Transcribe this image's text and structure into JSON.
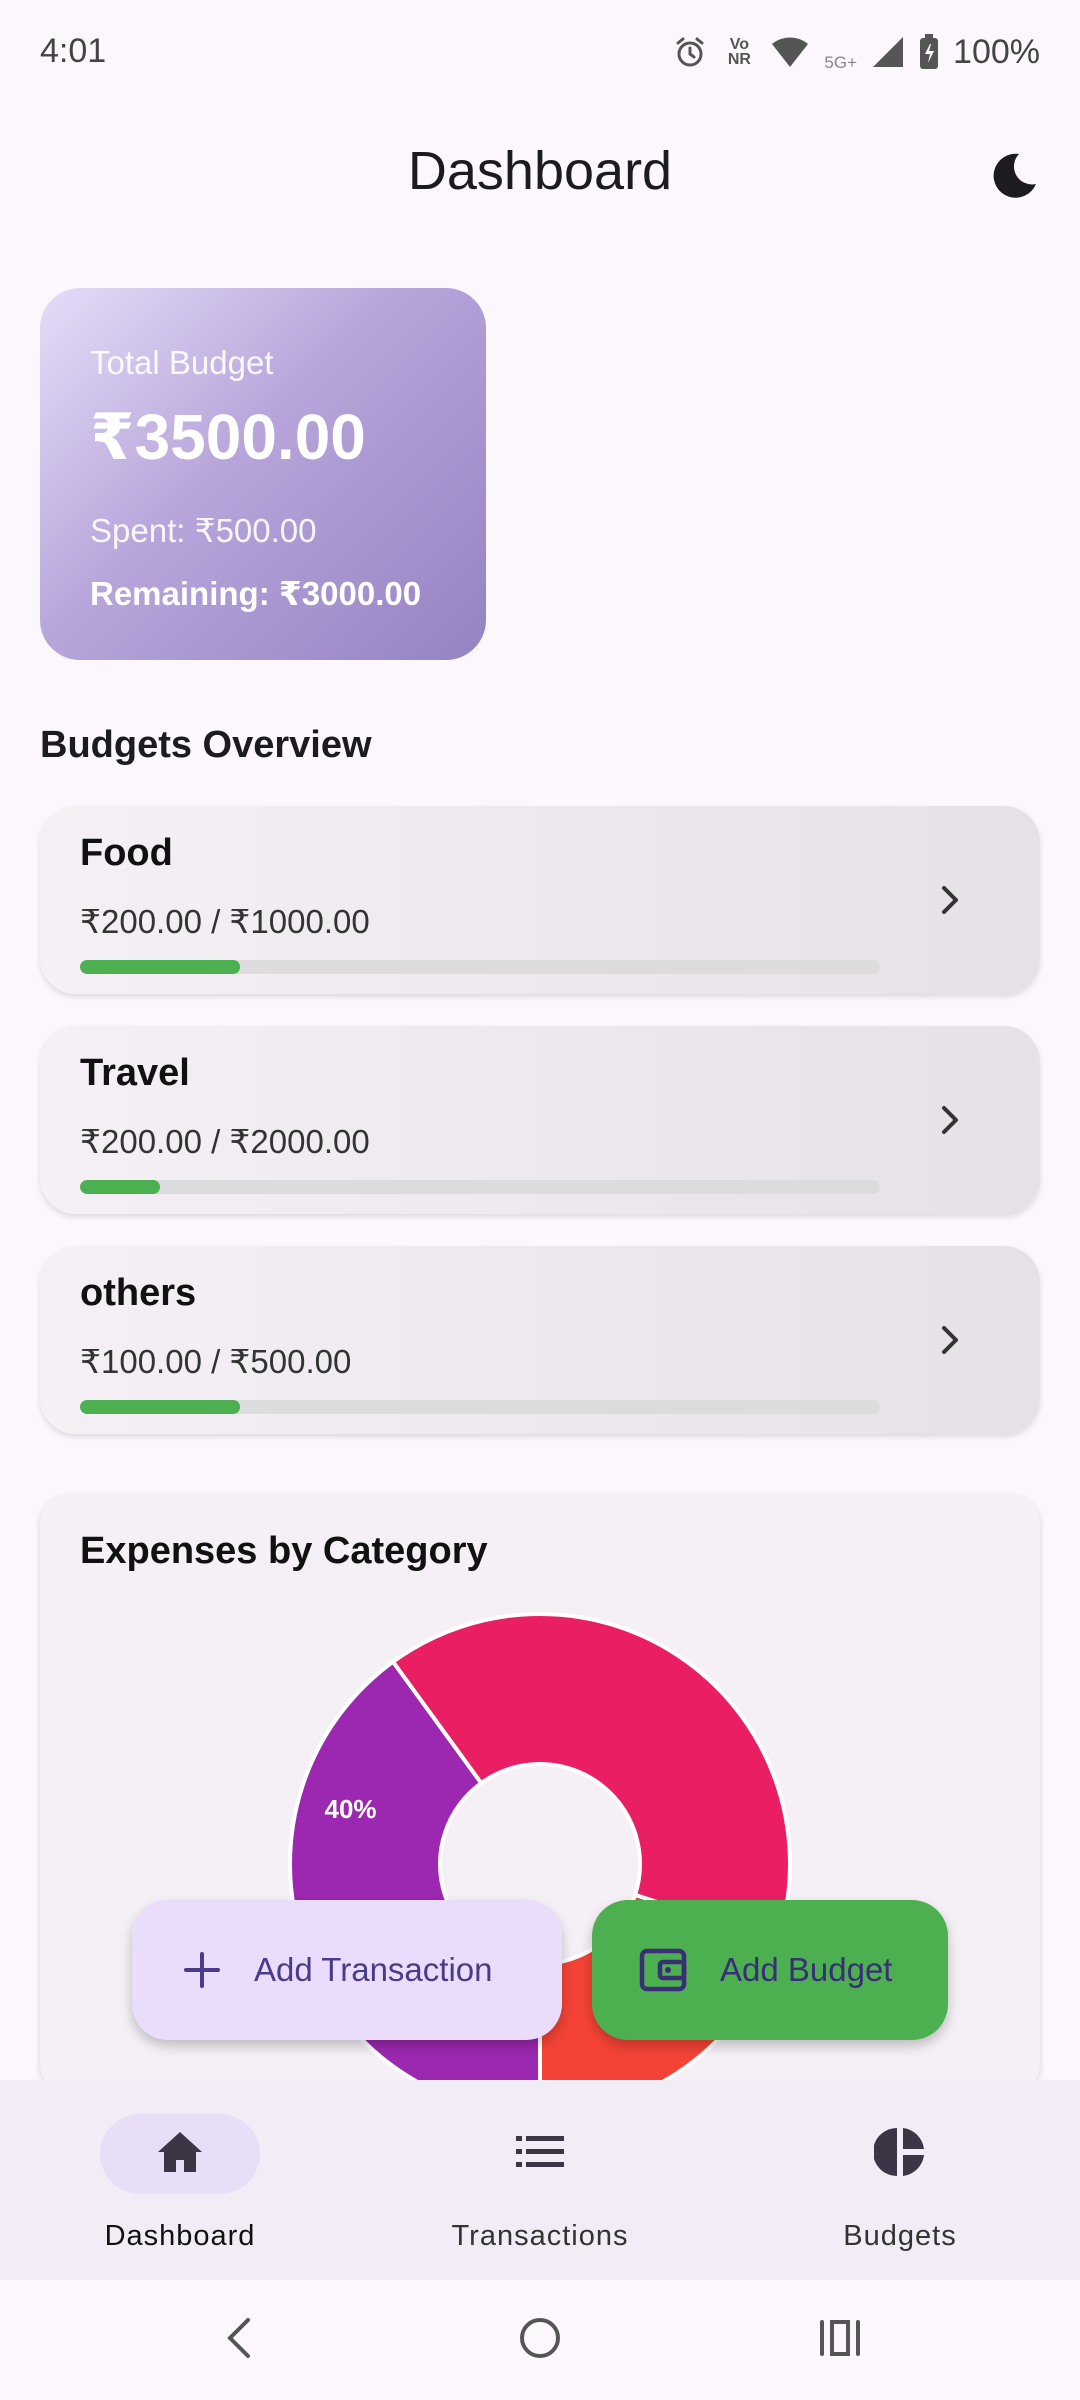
{
  "status_bar": {
    "time": "4:01",
    "volte_label": "Vo NR",
    "network_label": "5G+",
    "battery": "100%",
    "icons": [
      "alarm-icon",
      "volte-icon",
      "wifi-icon",
      "signal-icon",
      "battery-charging-icon"
    ]
  },
  "header": {
    "title": "Dashboard",
    "theme_icon": "moon-icon"
  },
  "budget_card": {
    "label": "Total Budget",
    "total": "₹3500.00",
    "spent": "Spent: ₹500.00",
    "remaining": "Remaining: ₹3000.00"
  },
  "budgets_overview": {
    "title": "Budgets Overview",
    "items": [
      {
        "name": "Food",
        "amount": "₹200.00 / ₹1000.00",
        "progress": 0.2
      },
      {
        "name": "Travel",
        "amount": "₹200.00 / ₹2000.00",
        "progress": 0.1
      },
      {
        "name": "others",
        "amount": "₹100.00 / ₹500.00",
        "progress": 0.2
      }
    ]
  },
  "expenses_chart": {
    "title": "Expenses by Category"
  },
  "chart_data": {
    "type": "pie",
    "title": "Expenses by Category",
    "slices": [
      {
        "value": 40,
        "color": "#9C27B0",
        "label": "40%"
      },
      {
        "value": 40,
        "color": "#E91E63",
        "label": ""
      },
      {
        "value": 20,
        "color": "#F44336",
        "label": ""
      }
    ]
  },
  "fabs": {
    "add_transaction": "Add Transaction",
    "add_budget": "Add Budget"
  },
  "bottom_nav": {
    "items": [
      {
        "label": "Dashboard",
        "icon": "home-icon",
        "active": true
      },
      {
        "label": "Transactions",
        "icon": "list-icon",
        "active": false
      },
      {
        "label": "Budgets",
        "icon": "pie-chart-icon",
        "active": false
      }
    ]
  },
  "colors": {
    "accent": "#4CAF50",
    "primary_container": "#EADDFB",
    "background": "#FCF7FC"
  }
}
